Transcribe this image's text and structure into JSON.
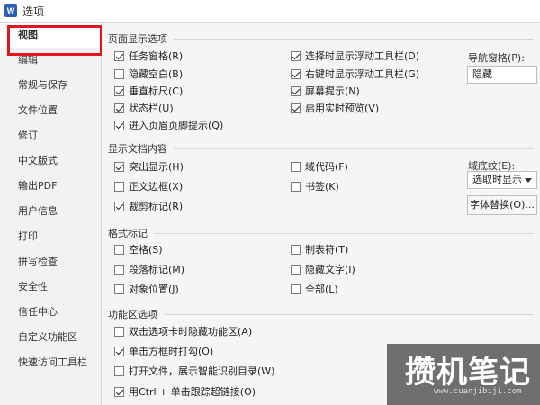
{
  "window": {
    "title": "选项",
    "app_icon_letter": "W"
  },
  "sidebar": {
    "items": [
      {
        "label": "视图"
      },
      {
        "label": "编辑"
      },
      {
        "label": "常规与保存"
      },
      {
        "label": "文件位置"
      },
      {
        "label": "修订"
      },
      {
        "label": "中文版式"
      },
      {
        "label": "输出PDF"
      },
      {
        "label": "用户信息"
      },
      {
        "label": "打印"
      },
      {
        "label": "拼写检查"
      },
      {
        "label": "安全性"
      },
      {
        "label": "信任中心"
      },
      {
        "label": "自定义功能区"
      },
      {
        "label": "快速访问工具栏"
      }
    ],
    "active_index": 0
  },
  "sections": {
    "page_display": {
      "title": "页面显示选项",
      "left": [
        {
          "label": "任务窗格(R)",
          "checked": true
        },
        {
          "label": "隐藏空白(B)",
          "checked": false
        },
        {
          "label": "垂直标尺(C)",
          "checked": true
        },
        {
          "label": "状态栏(U)",
          "checked": true
        },
        {
          "label": "进入页眉页脚提示(Q)",
          "checked": true
        }
      ],
      "right": [
        {
          "label": "选择时显示浮动工具栏(D)",
          "checked": true
        },
        {
          "label": "右键时显示浮动工具栏(G)",
          "checked": true
        },
        {
          "label": "屏幕提示(N)",
          "checked": true
        },
        {
          "label": "启用实时预览(V)",
          "checked": true
        }
      ],
      "nav_pane_label": "导航窗格(P):",
      "nav_pane_value": "隐藏"
    },
    "doc_content": {
      "title": "显示文档内容",
      "left": [
        {
          "label": "突出显示(H)",
          "checked": true
        },
        {
          "label": "正文边框(X)",
          "checked": false
        },
        {
          "label": "裁剪标记(R)",
          "checked": true
        }
      ],
      "right": [
        {
          "label": "域代码(F)",
          "checked": false
        },
        {
          "label": "书签(K)",
          "checked": false
        }
      ],
      "field_shading_label": "域底纹(E):",
      "field_shading_value": "选取时显示",
      "font_sub_button": "字体替换(O)..."
    },
    "format_marks": {
      "title": "格式标记",
      "left": [
        {
          "label": "空格(S)",
          "checked": false
        },
        {
          "label": "段落标记(M)",
          "checked": false
        },
        {
          "label": "对象位置(J)",
          "checked": false
        }
      ],
      "right": [
        {
          "label": "制表符(T)",
          "checked": false
        },
        {
          "label": "隐藏文字(I)",
          "checked": false
        },
        {
          "label": "全部(L)",
          "checked": false
        }
      ]
    },
    "ribbon": {
      "title": "功能区选项",
      "items": [
        {
          "label": "双击选项卡时隐藏功能区(A)",
          "checked": false
        },
        {
          "label": "单击方框时打勾(O)",
          "checked": true
        },
        {
          "label": "打开文件，展示智能识别目录(W)",
          "checked": false
        },
        {
          "label": "用Ctrl + 单击跟踪超链接(O)",
          "checked": true
        }
      ]
    }
  },
  "watermark": {
    "text": "攒机笔记",
    "url": "www.cuanjibiji.com"
  },
  "highlight_color": "#e3141b"
}
